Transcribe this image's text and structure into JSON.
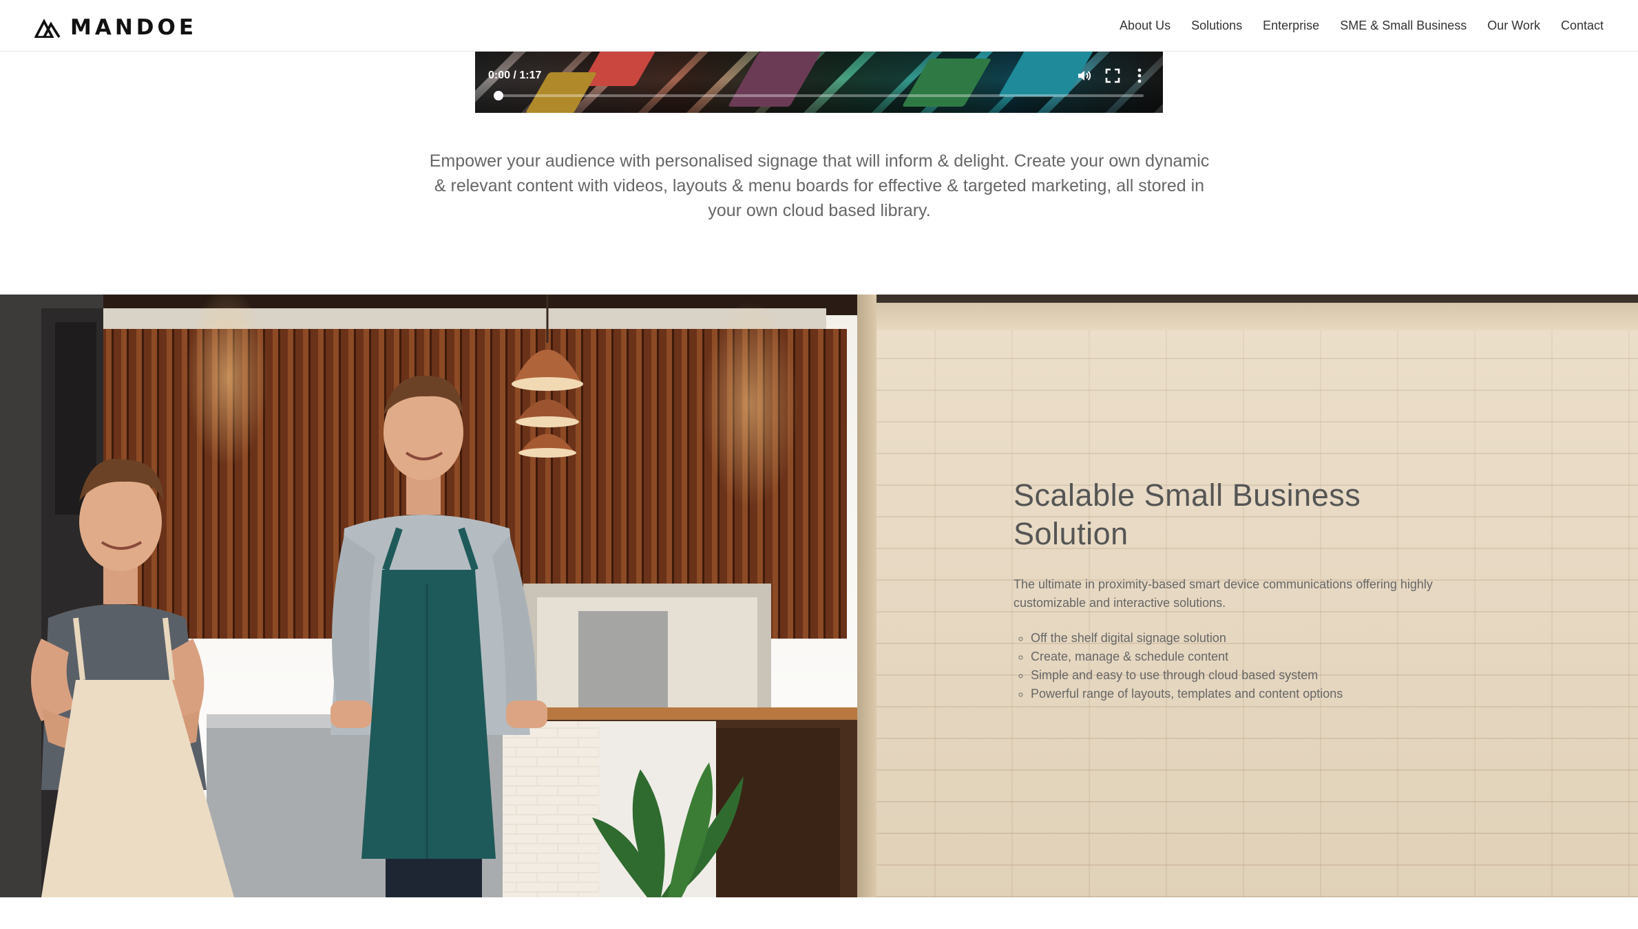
{
  "header": {
    "brand": "MANDOE",
    "nav": [
      {
        "label": "About Us"
      },
      {
        "label": "Solutions"
      },
      {
        "label": "Enterprise"
      },
      {
        "label": "SME & Small Business"
      },
      {
        "label": "Our Work"
      },
      {
        "label": "Contact"
      }
    ]
  },
  "video": {
    "time": "0:00 / 1:17",
    "progress": 0,
    "icons": [
      "volume-icon",
      "fullscreen-icon",
      "more-options-icon"
    ]
  },
  "intro": {
    "text": "Empower your audience with personalised signage that will inform & delight. Create your own dynamic & relevant content with videos, layouts & menu boards for effective & targeted marketing, all stored in your own cloud based library."
  },
  "hero": {
    "title": "Scalable Small Business Solution",
    "description": "The ultimate in proximity-based smart device communications offering highly customizable and interactive solutions.",
    "features": [
      "Off the shelf digital signage solution",
      "Create, manage & schedule content",
      "Simple and easy to use through cloud based system",
      "Powerful range of layouts, templates and content options"
    ]
  },
  "colors": {
    "text": "#666666",
    "wall": "#e8d8bf",
    "apron_teal": "#1f5a5a"
  }
}
